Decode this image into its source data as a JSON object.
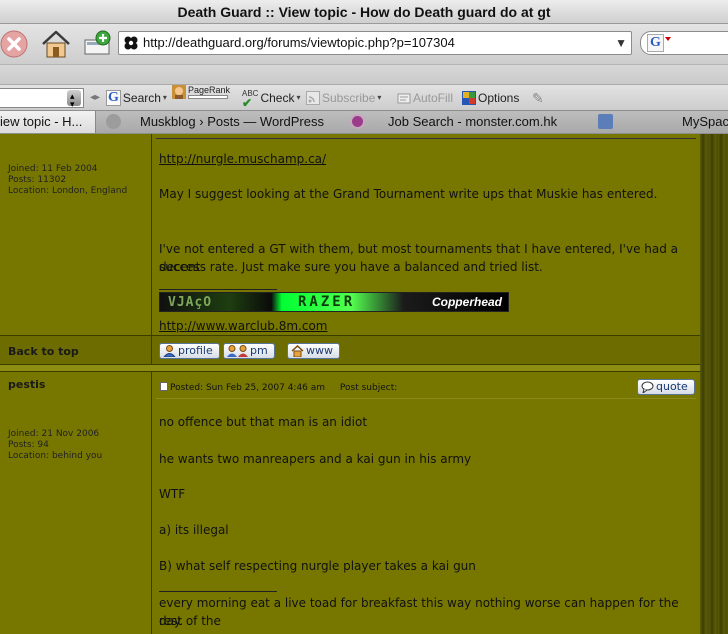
{
  "window": {
    "title": "Death Guard :: View topic - How do Death guard do at gt"
  },
  "navigation": {
    "url": "http://deathguard.org/forums/viewtopic.php?p=107304",
    "search_engine_letter": "G"
  },
  "google_toolbar": {
    "search_label": "Search",
    "pagerank_label": "PageRank",
    "check_label": "Check",
    "subscribe_label": "Subscribe",
    "autofill_label": "AutoFill",
    "options_label": "Options"
  },
  "tabs": [
    {
      "label": "iew topic - H...",
      "active": true
    },
    {
      "label": "Muskblog › Posts — WordPress",
      "active": false
    },
    {
      "label": "Job Search - monster.com.hk",
      "active": false
    },
    {
      "label": "MySpace",
      "active": false
    }
  ],
  "posts": [
    {
      "poster_details": [
        "Joined: 11 Feb 2004",
        "Posts: 11302",
        "Location: London, England"
      ],
      "body": [
        "http://nurgle.muschamp.ca/",
        "May I suggest looking at the Grand Tournament write ups that Muskie has entered.",
        "I've not entered a GT with them, but most tournaments that I have entered, I've had a decent",
        "success rate. Just make sure you have a balanced and tried list."
      ],
      "signature": {
        "banner_left": "VJAçO",
        "banner_word": "RAZER",
        "banner_tag": "Copperhead",
        "link": "http://www.warclub.8m.com"
      },
      "back_to_top": "Back to top",
      "buttons": {
        "profile": "profile",
        "pm": "pm",
        "www": "www"
      }
    },
    {
      "poster_name": "pestis",
      "poster_details": [
        "Joined: 21 Nov 2006",
        "Posts: 94",
        "Location: behind you"
      ],
      "posted_line": "Posted: Sun Feb 25, 2007 4:46 am",
      "subject_label": "Post subject:",
      "quote_label": "quote",
      "body": [
        "no offence but that man is an idiot",
        "he wants two manreapers and a kai gun in his army",
        "WTF",
        "a) its illegal",
        "B) what self respecting nurgle player takes a kai gun",
        "every morning eat a live toad for breakfast this way nothing worse can happen for the rest of the",
        "day."
      ]
    }
  ]
}
